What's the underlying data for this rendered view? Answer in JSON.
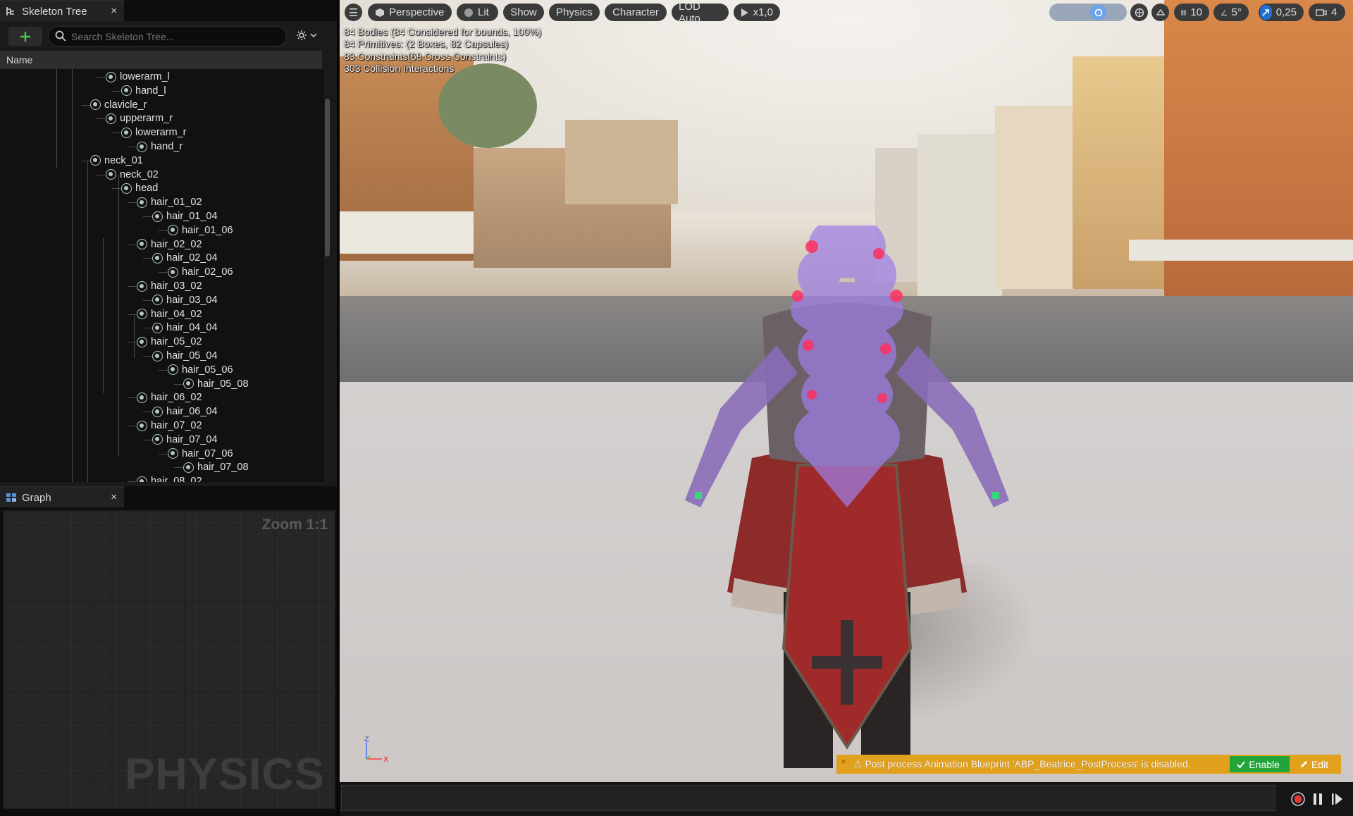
{
  "skeleton_panel": {
    "tab_title": "Skeleton Tree",
    "close_glyph": "×",
    "search_placeholder": "Search Skeleton Tree...",
    "column_name": "Name",
    "bones": [
      "lowerarm_l",
      "hand_l",
      "clavicle_r",
      "upperarm_r",
      "lowerarm_r",
      "hand_r",
      "neck_01",
      "neck_02",
      "head",
      "hair_01_02",
      "hair_01_04",
      "hair_01_06",
      "hair_02_02",
      "hair_02_04",
      "hair_02_06",
      "hair_03_02",
      "hair_03_04",
      "hair_04_02",
      "hair_04_04",
      "hair_05_02",
      "hair_05_04",
      "hair_05_06",
      "hair_05_08",
      "hair_06_02",
      "hair_06_04",
      "hair_07_02",
      "hair_07_04",
      "hair_07_06",
      "hair_07_08",
      "hair_08_02"
    ]
  },
  "graph_panel": {
    "tab_title": "Graph",
    "close_glyph": "×",
    "zoom_label": "Zoom 1:1",
    "watermark": "PHYSICS"
  },
  "viewport": {
    "buttons": {
      "menu": "☰",
      "perspective": "Perspective",
      "lit": "Lit",
      "show": "Show",
      "physics": "Physics",
      "character": "Character",
      "lod": "LOD Auto",
      "speed": "x1,0"
    },
    "right_controls": {
      "grid_snap": "10",
      "angle_snap": "5°",
      "scale_snap": "0,25",
      "camera_speed": "4"
    },
    "stats": [
      "84 Bodies (84 Considered for bounds, 100%)",
      "84 Primitives: (2 Boxes, 82 Capsules)",
      "83 Constraints(68 Cross Constraints)",
      "303 Collision Interactions"
    ],
    "axis": {
      "z": "Z",
      "x": "X"
    },
    "warning": {
      "message": "Post process Animation Blueprint 'ABP_Beatrice_PostProcess' is disabled.",
      "enable_label": "Enable",
      "edit_label": "Edit"
    },
    "colors": {
      "accent": "#1f6fd6",
      "warning": "#e2a11d",
      "enable": "#22a43a",
      "record": "#e03a3a"
    }
  }
}
